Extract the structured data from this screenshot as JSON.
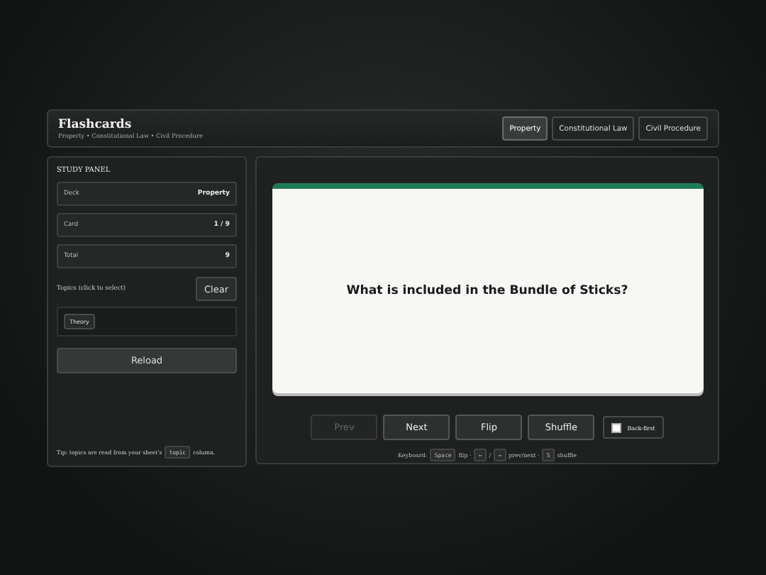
{
  "header": {
    "title": "Flashcards",
    "subtitle": "Property • Constitutional Law • Civil Procedure",
    "decks": [
      {
        "label": "Property",
        "selected": true
      },
      {
        "label": "Constitutional Law",
        "selected": false
      },
      {
        "label": "Civil Procedure",
        "selected": false
      }
    ]
  },
  "study_panel": {
    "title": "STUDY PANEL",
    "stats": [
      {
        "label": "Deck",
        "value": "Property"
      },
      {
        "label": "Card",
        "value": "1 / 9"
      },
      {
        "label": "Total",
        "value": "9"
      }
    ],
    "topics_label": "Topics (click to select)",
    "clear_button": "Clear",
    "topics": [
      {
        "label": "Theory",
        "selected": false
      }
    ],
    "reload_button": "Reload",
    "tip": [
      {
        "kind": "text",
        "text": "Tip: topics are read from your sheet's"
      },
      {
        "kind": "key",
        "text": "topic"
      },
      {
        "kind": "text",
        "text": "column."
      }
    ]
  },
  "card": {
    "question": "What is included in the Bundle of Sticks?"
  },
  "controls": [
    {
      "label": "Prev",
      "disabled": true
    },
    {
      "label": "Next",
      "disabled": false
    },
    {
      "label": "Flip",
      "disabled": false
    },
    {
      "label": "Shuffle",
      "disabled": false
    }
  ],
  "back_first": {
    "label": "Back-first",
    "checked": false
  },
  "keyboard_hint": [
    {
      "kind": "text",
      "text": "Keyboard:"
    },
    {
      "kind": "key",
      "text": "Space"
    },
    {
      "kind": "text",
      "text": "flip ·"
    },
    {
      "kind": "key",
      "text": "←"
    },
    {
      "kind": "text",
      "text": "/"
    },
    {
      "kind": "key",
      "text": "→"
    },
    {
      "kind": "text",
      "text": "prev/next ·"
    },
    {
      "kind": "key",
      "text": "S"
    },
    {
      "kind": "text",
      "text": "shuffle"
    }
  ]
}
